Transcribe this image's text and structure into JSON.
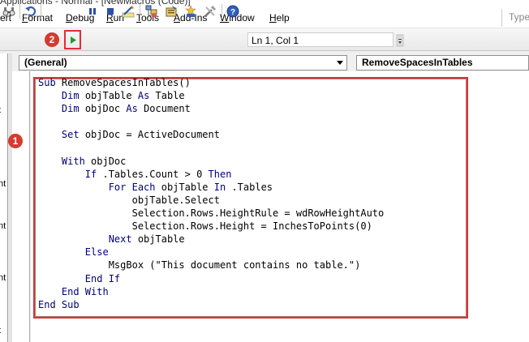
{
  "window": {
    "title_fragment": "Applications - Normal - [NewMacros (Code)]"
  },
  "menu": {
    "items": [
      {
        "pre": "",
        "mn": "",
        "post": "ert"
      },
      {
        "pre": "",
        "mn": "F",
        "post": "ormat"
      },
      {
        "pre": "",
        "mn": "D",
        "post": "ebug"
      },
      {
        "pre": "",
        "mn": "R",
        "post": "un"
      },
      {
        "pre": "",
        "mn": "T",
        "post": "ools"
      },
      {
        "pre": "",
        "mn": "A",
        "post": "dd-Ins"
      },
      {
        "pre": "",
        "mn": "W",
        "post": "indow"
      },
      {
        "pre": "",
        "mn": "H",
        "post": "elp"
      }
    ],
    "help_placeholder": "Type"
  },
  "toolbar": {
    "status": "Ln 1, Col 1",
    "icons": [
      "find-icon",
      "undo-icon",
      "run-icon",
      "break-icon",
      "reset-icon",
      "design-mode-icon",
      "project-explorer-icon",
      "properties-icon",
      "object-browser-icon",
      "toolbox-icon",
      "help-icon"
    ],
    "run_color": "#1e9b2f"
  },
  "code_window": {
    "object_combo": "(General)",
    "procedure_combo": "RemoveSpacesInTables"
  },
  "code": {
    "lines": [
      [
        {
          "t": "Sub ",
          "k": true
        },
        {
          "t": "RemoveSpacesInTables()",
          "k": false
        }
      ],
      [
        {
          "t": "    ",
          "k": false
        },
        {
          "t": "Dim ",
          "k": true
        },
        {
          "t": "objTable ",
          "k": false
        },
        {
          "t": "As ",
          "k": true
        },
        {
          "t": "Table",
          "k": false
        }
      ],
      [
        {
          "t": "    ",
          "k": false
        },
        {
          "t": "Dim ",
          "k": true
        },
        {
          "t": "objDoc ",
          "k": false
        },
        {
          "t": "As ",
          "k": true
        },
        {
          "t": "Document",
          "k": false
        }
      ],
      [],
      [
        {
          "t": "    ",
          "k": false
        },
        {
          "t": "Set ",
          "k": true
        },
        {
          "t": "objDoc = ActiveDocument",
          "k": false
        }
      ],
      [],
      [
        {
          "t": "    ",
          "k": false
        },
        {
          "t": "With ",
          "k": true
        },
        {
          "t": "objDoc",
          "k": false
        }
      ],
      [
        {
          "t": "        ",
          "k": false
        },
        {
          "t": "If ",
          "k": true
        },
        {
          "t": ".Tables.Count > 0 ",
          "k": false
        },
        {
          "t": "Then",
          "k": true
        }
      ],
      [
        {
          "t": "            ",
          "k": false
        },
        {
          "t": "For Each ",
          "k": true
        },
        {
          "t": "objTable ",
          "k": false
        },
        {
          "t": "In ",
          "k": true
        },
        {
          "t": ".Tables",
          "k": false
        }
      ],
      [
        {
          "t": "                objTable.Select",
          "k": false
        }
      ],
      [
        {
          "t": "                Selection.Rows.HeightRule = wdRowHeightAuto",
          "k": false
        }
      ],
      [
        {
          "t": "                Selection.Rows.Height = InchesToPoints(0)",
          "k": false
        }
      ],
      [
        {
          "t": "            ",
          "k": false
        },
        {
          "t": "Next ",
          "k": true
        },
        {
          "t": "objTable",
          "k": false
        }
      ],
      [
        {
          "t": "        ",
          "k": false
        },
        {
          "t": "Else",
          "k": true
        }
      ],
      [
        {
          "t": "            MsgBox (\"This document contains no table.\")",
          "k": false
        }
      ],
      [
        {
          "t": "        ",
          "k": false
        },
        {
          "t": "End If",
          "k": true
        }
      ],
      [
        {
          "t": "    ",
          "k": false
        },
        {
          "t": "End With",
          "k": true
        }
      ],
      [
        {
          "t": "End Sub",
          "k": true
        }
      ]
    ]
  },
  "left_pane": {
    "fragments": [
      "t",
      "nt",
      "nt",
      "nt",
      "t"
    ]
  },
  "annotations": {
    "marker1": "1",
    "marker2": "2",
    "accent_color": "#e22c3c"
  }
}
